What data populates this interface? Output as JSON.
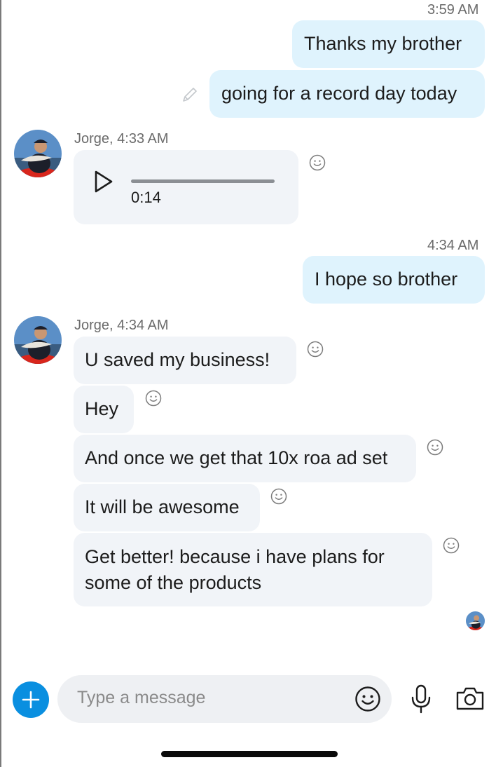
{
  "conversation": {
    "messages": [
      {
        "time": "3:59 AM"
      },
      {
        "text": "Thanks my brother"
      },
      {
        "text": "going for a record day today"
      },
      {
        "sender_line": "Jorge, 4:33 AM",
        "voice_duration": "0:14"
      },
      {
        "time": "4:34 AM"
      },
      {
        "text": "I hope so brother"
      },
      {
        "sender_line": "Jorge, 4:34 AM"
      },
      {
        "text": "U saved my business!"
      },
      {
        "text": "Hey"
      },
      {
        "text": "And once we get that 10x roa ad set"
      },
      {
        "text": "It will be awesome"
      },
      {
        "text_line1": "Get better! because i have plans for",
        "text_line2": "some of the products"
      }
    ]
  },
  "composer": {
    "placeholder": "Type a message",
    "icons": [
      "plus-icon",
      "smiley-icon",
      "microphone-icon",
      "camera-icon"
    ]
  },
  "colors": {
    "outgoing_bubble": "#dff3fd",
    "incoming_bubble": "#f1f4f8",
    "accent": "#0a8fe0"
  }
}
